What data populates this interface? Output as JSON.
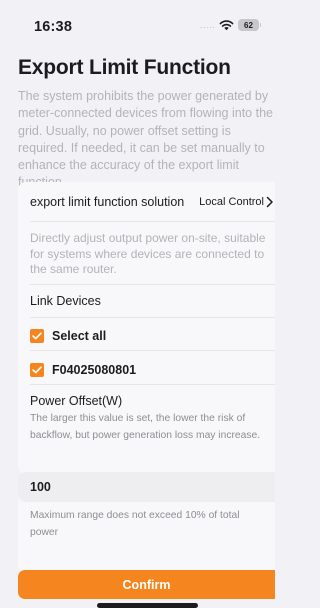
{
  "status_bar": {
    "time": "16:38",
    "signal": ".....",
    "wifi_icon": "wifi-icon",
    "battery_level": "62"
  },
  "page": {
    "title": "Export Limit Function",
    "description": "The system prohibits the power generated by meter-connected devices from flowing into the grid. Usually, no power offset setting is required. If needed, it can be set manually to enhance the accuracy of the export limit function.."
  },
  "solution": {
    "label": "export limit function solution",
    "value": "Local Control",
    "chevron_icon": "chevron-right-icon",
    "description": "Directly adjust output power on-site, suitable for systems where devices are connected to the same router."
  },
  "link_devices": {
    "title": "Link Devices",
    "select_all_label": "Select all",
    "select_all_checked": true,
    "devices": [
      {
        "serial": "F04025080801",
        "checked": true
      }
    ]
  },
  "power_offset": {
    "title": "Power Offset(W)",
    "hint": "The larger this value is set, the lower the risk of backflow, but power generation loss may increase.",
    "value": "100",
    "range_note": "Maximum range does not exceed 10% of total power"
  },
  "actions": {
    "confirm_label": "Confirm"
  },
  "colors": {
    "accent": "#f5861f",
    "background": "#f2f2f6",
    "card": "#f8f8fa",
    "muted_text": "#b3b3b8"
  }
}
